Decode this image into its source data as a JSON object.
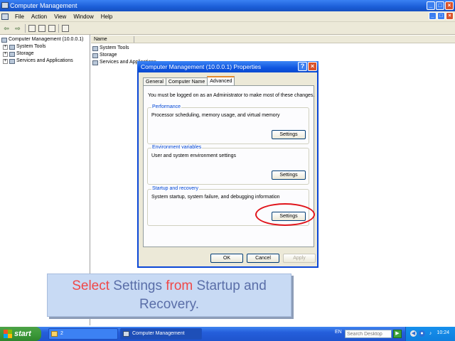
{
  "window": {
    "title": "Computer Management",
    "buttons": [
      "_",
      "□",
      "×"
    ]
  },
  "menu": {
    "items": [
      "File",
      "Action",
      "View",
      "Window",
      "Help"
    ],
    "mdi_buttons": [
      "_",
      "□",
      "×"
    ]
  },
  "toolbar": {
    "back_glyph": "⇦",
    "forward_glyph": "⇨"
  },
  "tree": {
    "root": "Computer Management (10.0.0.1)",
    "items": [
      {
        "label": "System Tools",
        "expander": "+"
      },
      {
        "label": "Storage",
        "expander": "+"
      },
      {
        "label": "Services and Applications",
        "expander": "+"
      }
    ]
  },
  "list": {
    "column": "Name",
    "rows": [
      "System Tools",
      "Storage",
      "Services and Applications"
    ]
  },
  "dialog": {
    "title": "Computer Management (10.0.0.1) Properties",
    "help_glyph": "?",
    "close_glyph": "×",
    "tabs": [
      "General",
      "Computer Name",
      "Advanced"
    ],
    "active_tab": "Advanced",
    "note": "You must be logged on as an Administrator to make most of these changes.",
    "groups": [
      {
        "title": "Performance",
        "description": "Processor scheduling, memory usage, and virtual memory",
        "button": "Settings"
      },
      {
        "title": "Environment variables",
        "description": "User and system environment settings",
        "button": "Settings"
      },
      {
        "title": "Startup and recovery",
        "description": "System startup, system failure, and debugging information",
        "button": "Settings"
      }
    ],
    "ok": "OK",
    "cancel": "Cancel",
    "apply": "Apply"
  },
  "caption": {
    "line1": [
      "Select",
      " Settings",
      " from",
      " Startup and"
    ],
    "line2": "Recovery."
  },
  "taskbar": {
    "start": "start",
    "tasks": [
      "2",
      "Computer Management"
    ],
    "language": "EN",
    "search_placeholder": "Search Desktop",
    "clock": "10:24"
  },
  "colors": {
    "highlight_ring": "#e0141b",
    "caption_red": "#f04848",
    "caption_blue": "#5a6ea8",
    "title_blue": "#0a46d6"
  }
}
